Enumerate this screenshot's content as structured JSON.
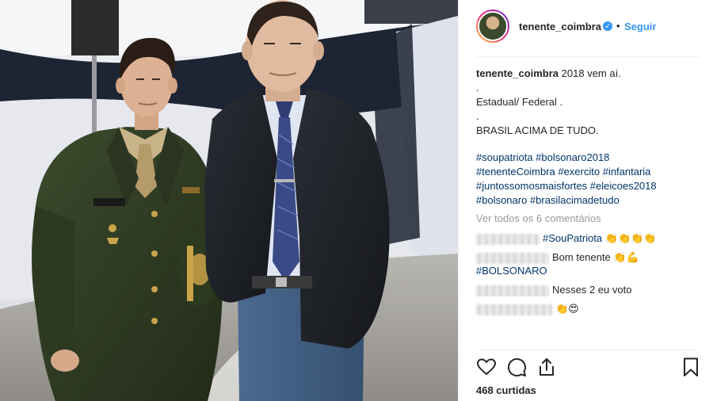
{
  "post": {
    "username": "tenente_coimbra",
    "follow_label": "Seguir",
    "separator": "•",
    "verified_glyph": "✓"
  },
  "caption": {
    "username": "tenente_coimbra",
    "text": "2018 vem aí.",
    "line_2": ".",
    "line_3": "Estadual/ Federal .",
    "line_4": ".",
    "line_5": "BRASIL ACIMA DE TUDO."
  },
  "hashtags": [
    "#soupatriota #bolsonaro2018",
    "#tenenteCoimbra #exercito #infantaria",
    "#juntossomosmaisfortes #eleicoes2018",
    "#bolsonaro #brasilacimadetudo"
  ],
  "view_all_comments": "Ver todos os 6 comentários",
  "comments": [
    {
      "text": "#SouPatriota",
      "is_link": true,
      "emoji": "👏👏👏👏"
    },
    {
      "text": "Bom tenente",
      "is_link": false,
      "emoji": "👏💪"
    },
    {
      "text": "#BOLSONARO",
      "is_link": true,
      "emoji": ""
    },
    {
      "text": "Nesses 2 eu voto",
      "is_link": false,
      "emoji": ""
    },
    {
      "text": "",
      "is_link": false,
      "emoji": "👏😍"
    }
  ],
  "actions": {
    "like_icon": "heart-icon",
    "comment_icon": "comment-icon",
    "share_icon": "share-icon",
    "save_icon": "bookmark-icon"
  },
  "likes": "468 curtidas",
  "colors": {
    "link": "#003569",
    "follow": "#3897f0",
    "muted": "#999999",
    "text": "#262626",
    "uniform": "#2f3a22",
    "blazer": "#1f2227",
    "tie": "#3a4a86"
  }
}
